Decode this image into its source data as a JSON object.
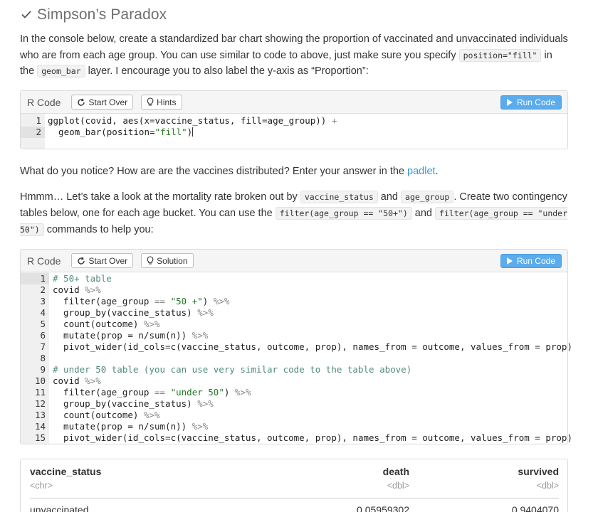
{
  "section": {
    "title": "Simpson’s Paradox",
    "icon": "check-icon"
  },
  "para1": {
    "t1": "In the console below, create a standardized bar chart showing the proportion of vaccinated and unvaccinated individuals who are from each age group. You can use similar to code to above, just make sure you specify ",
    "c1": "position=\"fill\"",
    "t2": " in the ",
    "c2": "geom_bar",
    "t3": " layer. I encourage you to also label the y-axis as “Proportion”:"
  },
  "exercise1": {
    "label": "R Code",
    "start_over": "Start Over",
    "hints": "Hints",
    "run": "Run Code",
    "lines": [
      {
        "n": "1",
        "code": "ggplot(covid, aes(x=vaccine_status, fill=age_group)) +"
      },
      {
        "n": "2",
        "code": "  geom_bar(position=\"fill\")"
      }
    ]
  },
  "para2": {
    "t1": "What do you notice? How are are the vaccines distributed? Enter your answer in the ",
    "link": "padlet",
    "t2": "."
  },
  "para3": {
    "t1": "Hmmm… Let’s take a look at the mortality rate broken out by ",
    "c1": "vaccine_status",
    "t2": " and ",
    "c2": "age_group",
    "t3": ". Create two contingency tables below, one for each age bucket. You can use the ",
    "c3": "filter(age_group == \"50+\")",
    "t4": " and ",
    "c4": "filter(age_group == \"under 50\")",
    "t5": " commands to help you:"
  },
  "exercise2": {
    "label": "R Code",
    "start_over": "Start Over",
    "solution": "Solution",
    "run": "Run Code",
    "lines": [
      {
        "n": "1",
        "code": "# 50+ table"
      },
      {
        "n": "2",
        "code": "covid %>%"
      },
      {
        "n": "3",
        "code": "  filter(age_group == \"50 +\") %>%"
      },
      {
        "n": "4",
        "code": "  group_by(vaccine_status) %>%"
      },
      {
        "n": "5",
        "code": "  count(outcome) %>%"
      },
      {
        "n": "6",
        "code": "  mutate(prop = n/sum(n)) %>%"
      },
      {
        "n": "7",
        "code": "  pivot_wider(id_cols=c(vaccine_status, outcome, prop), names_from = outcome, values_from = prop)"
      },
      {
        "n": "8",
        "code": ""
      },
      {
        "n": "9",
        "code": "# under 50 table (you can use very similar code to the table above)"
      },
      {
        "n": "10",
        "code": "covid %>%"
      },
      {
        "n": "11",
        "code": "  filter(age_group == \"under 50\") %>%"
      },
      {
        "n": "12",
        "code": "  group_by(vaccine_status) %>%"
      },
      {
        "n": "13",
        "code": "  count(outcome) %>%"
      },
      {
        "n": "14",
        "code": "  mutate(prop = n/sum(n)) %>%"
      },
      {
        "n": "15",
        "code": "  pivot_wider(id_cols=c(vaccine_status, outcome, prop), names_from = outcome, values_from = prop)"
      }
    ]
  },
  "result": {
    "columns": [
      "vaccine_status",
      "death",
      "survived"
    ],
    "types": [
      "<chr>",
      "<dbl>",
      "<dbl>"
    ],
    "rows": [
      [
        "unvaccinated",
        "0.05959302",
        "0.9404070"
      ]
    ]
  }
}
